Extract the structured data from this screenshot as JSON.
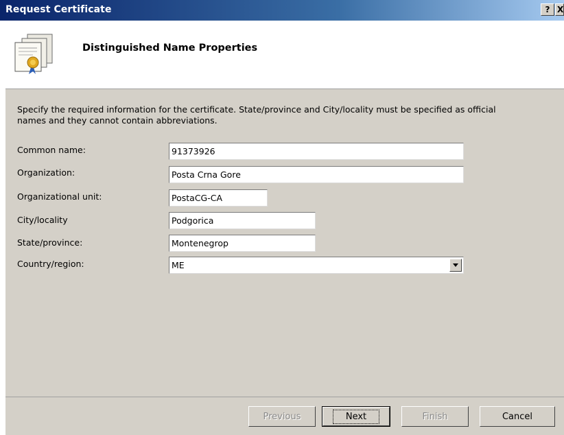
{
  "window": {
    "title": "Request Certificate",
    "help_glyph": "?",
    "close_glyph": "X"
  },
  "header": {
    "heading": "Distinguished Name Properties"
  },
  "description": "Specify the required information for the certificate. State/province and City/locality must be specified as official names and they cannot contain abbreviations.",
  "fields": [
    {
      "label": "Common name:",
      "value": "91373926"
    },
    {
      "label": "Organization:",
      "value": "Posta Crna Gore"
    },
    {
      "label": "Organizational unit:",
      "value": "PostaCG-CA"
    },
    {
      "label": "City/locality",
      "value": "Podgorica"
    },
    {
      "label": "State/province:",
      "value": "Montenegrop"
    },
    {
      "label": "Country/region:",
      "value": "ME"
    }
  ],
  "buttons": {
    "previous": "Previous",
    "next": "Next",
    "finish": "Finish",
    "cancel": "Cancel"
  },
  "icons": {
    "certificate": "certificate-stack-icon",
    "dropdown": "chevron-down-icon"
  },
  "colors": {
    "title_bar": "#0a246a",
    "dialog_face": "#d4d0c8",
    "header_bg": "#ffffff"
  }
}
